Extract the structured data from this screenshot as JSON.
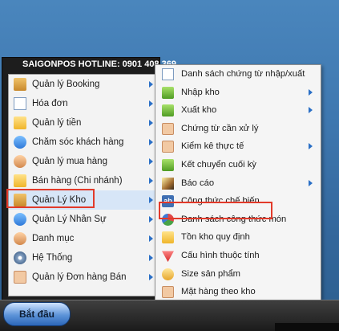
{
  "hotline": "SAIGONPOS HOTLINE: 0901 408 369",
  "start_button": "Bắt đầu",
  "left_menu": [
    {
      "label": "Quản lý Booking",
      "icon": "house-icon",
      "has_submenu": true
    },
    {
      "label": "Hóa đơn",
      "icon": "invoice-icon",
      "has_submenu": true
    },
    {
      "label": "Quản lý tiền",
      "icon": "folder-icon",
      "has_submenu": true
    },
    {
      "label": "Chăm sóc khách hàng",
      "icon": "customers-icon",
      "has_submenu": true
    },
    {
      "label": "Quản lý mua hàng",
      "icon": "person-icon",
      "has_submenu": true
    },
    {
      "label": "Bán hàng (Chi nhánh)",
      "icon": "folder-icon",
      "has_submenu": true
    },
    {
      "label": "Quản Lý Kho",
      "icon": "house-icon",
      "has_submenu": true
    },
    {
      "label": "Quản Lý Nhân Sự",
      "icon": "people-icon",
      "has_submenu": true
    },
    {
      "label": "Danh mục",
      "icon": "person-icon",
      "has_submenu": true
    },
    {
      "label": "Hệ Thống",
      "icon": "settings-doc-icon",
      "has_submenu": true
    },
    {
      "label": "Quản lý Đơn hàng Bán",
      "icon": "tag-icon",
      "has_submenu": true
    }
  ],
  "submenu": [
    {
      "label": "Danh sách chứng từ nhập/xuất",
      "icon": "list-doc-icon",
      "has_submenu": false
    },
    {
      "label": "Nhập kho",
      "icon": "import-icon",
      "has_submenu": true
    },
    {
      "label": "Xuất kho",
      "icon": "export-icon",
      "has_submenu": true
    },
    {
      "label": "Chứng từ cần xử lý",
      "icon": "tag-icon",
      "has_submenu": false
    },
    {
      "label": "Kiểm kê thực tế",
      "icon": "tag-icon",
      "has_submenu": true
    },
    {
      "label": "Kết chuyển cuối kỳ",
      "icon": "transfer-icon",
      "has_submenu": false
    },
    {
      "label": "Báo cáo",
      "icon": "wand-icon",
      "has_submenu": true
    },
    {
      "label": "Công thức chế biến",
      "icon": "ab-icon",
      "has_submenu": false
    },
    {
      "label": "Danh sách công thức món",
      "icon": "pie-icon",
      "has_submenu": false
    },
    {
      "label": "Tồn kho quy định",
      "icon": "folder-icon",
      "has_submenu": false
    },
    {
      "label": "Cấu hình thuộc tính",
      "icon": "red-shape-icon",
      "has_submenu": false
    },
    {
      "label": "Size sản phẩm",
      "icon": "size-icon",
      "has_submenu": false
    },
    {
      "label": "Mặt hàng theo kho",
      "icon": "tag-icon",
      "has_submenu": false
    }
  ]
}
